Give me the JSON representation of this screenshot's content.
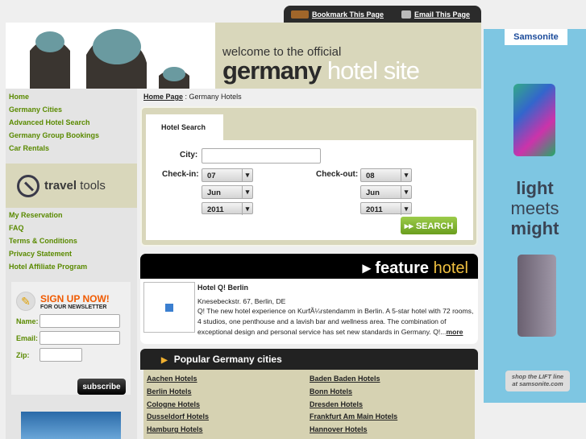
{
  "topbar": {
    "bookmark": "Bookmark This Page",
    "email": "Email This Page"
  },
  "header": {
    "welcome": "welcome to the official",
    "title_bold": "germany",
    "title_light": "hotel site"
  },
  "nav": [
    "Home",
    "Germany Cities",
    "Advanced Hotel Search",
    "Germany Group Bookings",
    "Car Rentals"
  ],
  "travel_tools": {
    "bold": "travel",
    "light": "tools",
    "links": [
      "My Reservation",
      "FAQ",
      "Terms & Conditions",
      "Privacy Statement",
      "Hotel Affiliate Program"
    ]
  },
  "newsletter": {
    "line1": "SIGN UP NOW!",
    "line2": "FOR OUR NEWSLETTER",
    "name_label": "Name:",
    "email_label": "Email:",
    "zip_label": "Zip:",
    "name": "",
    "email": "",
    "zip": "",
    "subscribe": "subscribe"
  },
  "breadcrumb": {
    "home": "Home Page",
    "sep": " : ",
    "current": "Germany Hotels"
  },
  "search": {
    "tab": "Hotel Search",
    "city_label": "City:",
    "city": "",
    "checkin_label": "Check-in:",
    "checkout_label": "Check-out:",
    "checkin": {
      "day": "07",
      "month": "Jun",
      "year": "2011"
    },
    "checkout": {
      "day": "08",
      "month": "Jun",
      "year": "2011"
    },
    "button": "▸▸ SEARCH"
  },
  "feature": {
    "heading_bold": "▸ feature",
    "heading_light": "hotel",
    "name": "Hotel Q! Berlin",
    "address": "Knesebeckstr. 67, Berlin, DE",
    "description": "Q! The new hotel experience on KurfÃ¼rstendamm in Berlin. A 5-star hotel with 72 rooms, 4 studios, one penthouse and a lavish bar and wellness area. The combination of exceptional design and personal service has set new standards in Germany. Q!...",
    "more": "more"
  },
  "popular": {
    "title": "Popular Germany cities",
    "cities": [
      "Aachen Hotels",
      "Baden Baden Hotels",
      "Berlin Hotels",
      "Bonn Hotels",
      "Cologne Hotels",
      "Dresden Hotels",
      "Dusseldorf Hotels",
      "Frankfurt Am Main Hotels",
      "Hamburg Hotels",
      "Hannover Hotels"
    ]
  },
  "ad": {
    "brand": "Samsonite",
    "slogan": [
      "light",
      "meets",
      "might"
    ],
    "cta1": "shop the LIFT line",
    "cta2": "at samsonite.com"
  }
}
